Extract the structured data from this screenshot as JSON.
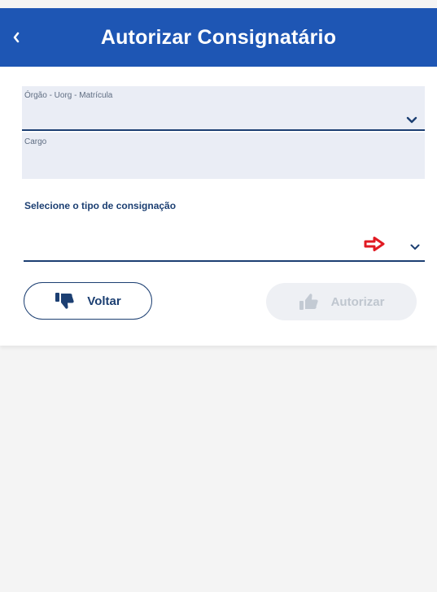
{
  "header": {
    "title": "Autorizar Consignatário",
    "back_icon": "chevron-left-icon"
  },
  "form": {
    "orgao_field": {
      "label": "Órgão - Uorg - Matrícula",
      "value": ""
    },
    "cargo_field": {
      "label": "Cargo",
      "value": ""
    },
    "consignacao_select": {
      "label": "Selecione o tipo de consignação",
      "value": "",
      "hint_icon": "red-arrow-right-icon"
    }
  },
  "actions": {
    "voltar": {
      "label": "Voltar",
      "icon": "thumbs-down-icon"
    },
    "autorizar": {
      "label": "Autorizar",
      "icon": "thumbs-up-icon",
      "disabled": true
    }
  },
  "colors": {
    "header": "#1e56b4",
    "primary": "#1c3f72",
    "field_bg": "#eaedf5",
    "hint_arrow": "#e11a22",
    "disabled": "#bfc6cf"
  }
}
